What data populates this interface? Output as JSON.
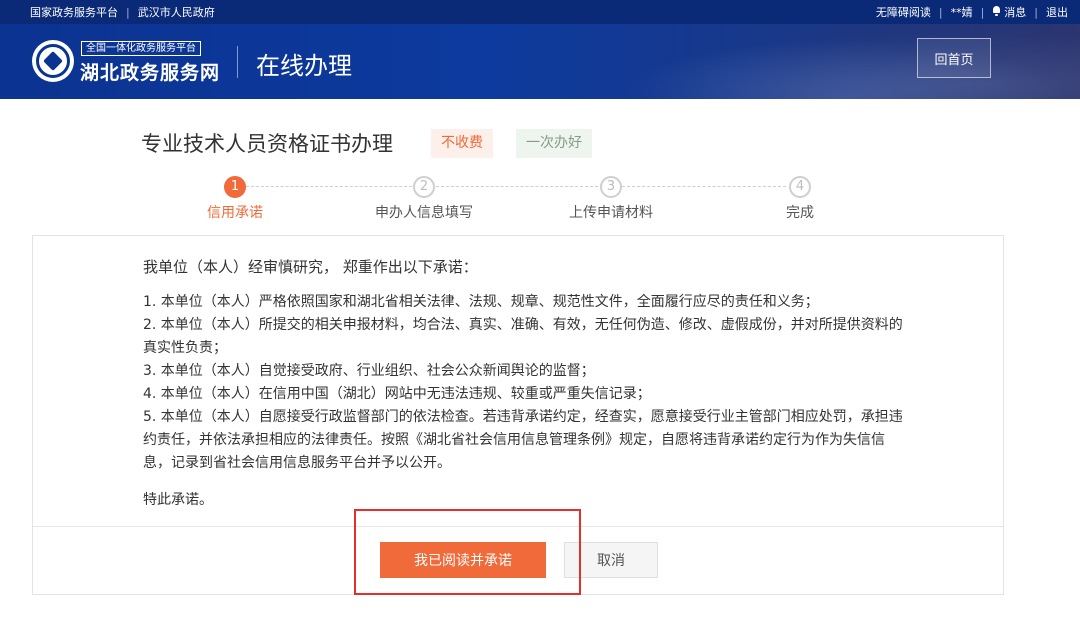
{
  "topbar": {
    "left_links": [
      "国家政务服务平台",
      "武汉市人民政府"
    ],
    "accessible_reading": "无障碍阅读",
    "user_name": "**婧",
    "messages": "消息",
    "logout": "退出"
  },
  "header": {
    "logo_small": "全国一体化政务服务平台",
    "logo_big": "湖北政务服务网",
    "section_title": "在线办理",
    "home_button": "回首页"
  },
  "page": {
    "title": "专业技术人员资格证书办理",
    "tags": [
      "不收费",
      "一次办好"
    ]
  },
  "steps": [
    {
      "number": "1",
      "label": "信用承诺",
      "active": true
    },
    {
      "number": "2",
      "label": "申办人信息填写",
      "active": false
    },
    {
      "number": "3",
      "label": "上传申请材料",
      "active": false
    },
    {
      "number": "4",
      "label": "完成",
      "active": false
    }
  ],
  "commitment": {
    "intro": "我单位（本人）经审慎研究， 郑重作出以下承诺：",
    "items": [
      "1. 本单位（本人）严格依照国家和湖北省相关法律、法规、规章、规范性文件，全面履行应尽的责任和义务；",
      "2. 本单位（本人）所提交的相关申报材料，均合法、真实、准确、有效，无任何伪造、修改、虚假成份，并对所提供资料的真实性负责；",
      "3. 本单位（本人）自觉接受政府、行业组织、社会公众新闻舆论的监督；",
      "4. 本单位（本人）在信用中国（湖北）网站中无违法违规、较重或严重失信记录；",
      "5. 本单位（本人）自愿接受行政监督部门的依法检查。若违背承诺约定，经查实，愿意接受行业主管部门相应处罚，承担违约责任，并依法承担相应的法律责任。按照《湖北省社会信用信息管理条例》规定，自愿将违背承诺约定行为作为失信信息，记录到省社会信用信息服务平台并予以公开。"
    ],
    "closing": "特此承诺。"
  },
  "actions": {
    "agree": "我已阅读并承诺",
    "cancel": "取消"
  },
  "colors": {
    "primary": "#f06a3a",
    "header_blue": "#0b3391",
    "highlight_red": "#e52e2e"
  }
}
